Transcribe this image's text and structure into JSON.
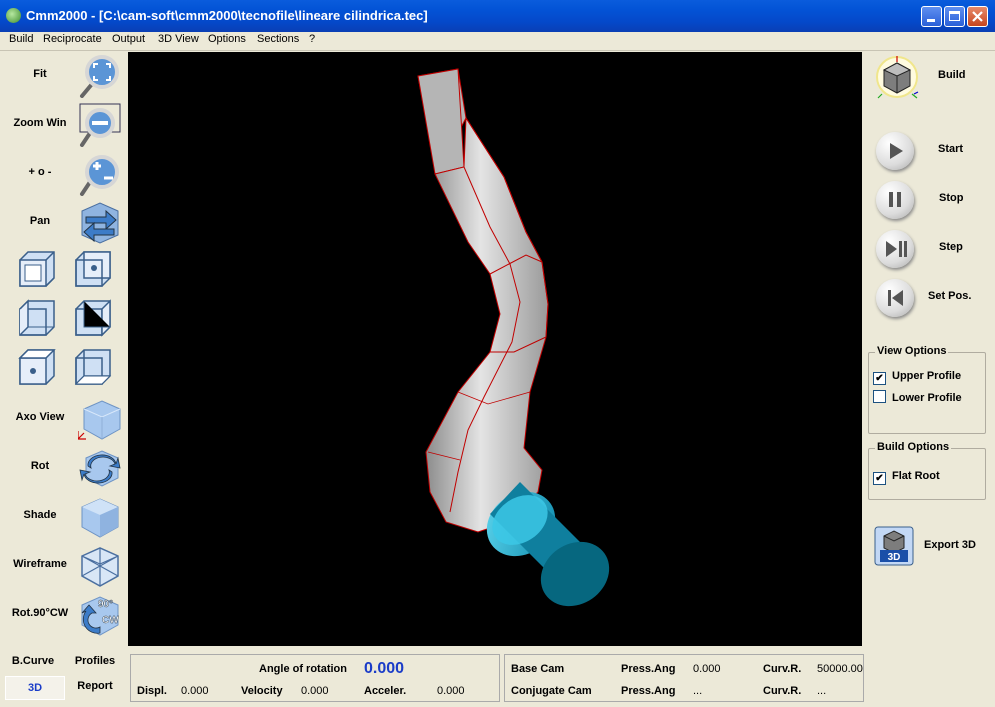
{
  "window": {
    "title": "Cmm2000 - [C:\\cam-soft\\cmm2000\\tecnofile\\lineare cilindrica.tec]"
  },
  "menu": [
    "Build",
    "Reciprocate",
    "Output",
    "3D View",
    "Options",
    "Sections",
    "?"
  ],
  "tools": {
    "fit": "Fit",
    "zoom_win": "Zoom Win",
    "zoom_pm": "+ o -",
    "pan": "Pan",
    "axo_view": "Axo View",
    "rot": "Rot",
    "shade": "Shade",
    "wireframe": "Wireframe",
    "rot90": "Rot.90°CW",
    "rot90_badge_top": "90°",
    "rot90_badge_bottom": "CW"
  },
  "bottom_left": {
    "bcurve": "B.Curve",
    "profiles": "Profiles",
    "three_d": "3D",
    "report": "Report"
  },
  "right": {
    "build": "Build",
    "start": "Start",
    "stop": "Stop",
    "step": "Step",
    "set_pos": "Set Pos.",
    "view_options": {
      "title": "View Options",
      "upper": "Upper Profile",
      "upper_checked": true,
      "lower": "Lower Profile",
      "lower_checked": false
    },
    "build_options": {
      "title": "Build Options",
      "flat_root": "Flat Root",
      "flat_root_checked": true
    },
    "export3d": "Export 3D",
    "export_badge": "3D"
  },
  "status": {
    "angle_label": "Angle of rotation",
    "angle_value": "0.000",
    "displ_label": "Displ.",
    "displ_value": "0.000",
    "velocity_label": "Velocity",
    "velocity_value": "0.000",
    "acceler_label": "Acceler.",
    "acceler_value": "0.000",
    "base_cam": "Base Cam",
    "conjugate_cam": "Conjugate Cam",
    "press_ang_label": "Press.Ang",
    "press_ang_base": "0.000",
    "press_ang_conj": "...",
    "curv_label": "Curv.R.",
    "curv_base": "50000.00",
    "curv_conj": "..."
  },
  "colors": {
    "viewport": "#000000",
    "angle_value": "#1a3cc8",
    "cam_body": "#c9c9c9",
    "cam_edges": "#c00000",
    "follower": "#0a6e8a"
  }
}
